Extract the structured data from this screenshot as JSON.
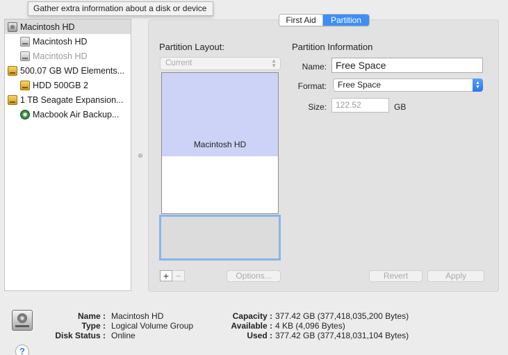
{
  "tooltip": "Gather extra information about a disk or device",
  "sidebar": {
    "items": [
      {
        "label": "Macintosh HD",
        "icon": "internal-disk-icon"
      },
      {
        "label": "Macintosh HD",
        "icon": "volume-icon"
      },
      {
        "label": "Macintosh HD",
        "icon": "volume-icon"
      },
      {
        "label": "500.07 GB WD Elements...",
        "icon": "external-disk-icon"
      },
      {
        "label": "HDD 500GB 2",
        "icon": "external-volume-icon"
      },
      {
        "label": "1 TB Seagate Expansion...",
        "icon": "external-disk-icon"
      },
      {
        "label": "Macbook Air Backup...",
        "icon": "time-machine-icon"
      }
    ]
  },
  "tabs": {
    "first_aid": "First Aid",
    "partition": "Partition",
    "active": "Partition"
  },
  "layout": {
    "title": "Partition Layout:",
    "scheme": "Current",
    "partition_name": "Macintosh HD",
    "add": "+",
    "remove": "−",
    "options": "Options..."
  },
  "info": {
    "title": "Partition Information",
    "name_label": "Name:",
    "name_value": "Free Space",
    "format_label": "Format:",
    "format_value": "Free Space",
    "size_label": "Size:",
    "size_value": "122.52",
    "size_unit": "GB"
  },
  "buttons": {
    "revert": "Revert",
    "apply": "Apply"
  },
  "details": {
    "name_key": "Name :",
    "name": "Macintosh HD",
    "type_key": "Type :",
    "type": "Logical Volume Group",
    "status_key": "Disk Status :",
    "status": "Online",
    "capacity_key": "Capacity :",
    "capacity": "377.42 GB (377,418,035,200 Bytes)",
    "available_key": "Available :",
    "available": "4 KB (4,096 Bytes)",
    "used_key": "Used :",
    "used": "377.42 GB (377,418,031,104 Bytes)"
  },
  "help": "?",
  "colors": {
    "accent": "#3d8ef6",
    "partition_fill": "#cdd3f6",
    "selection_ring": "#88b4e8"
  }
}
